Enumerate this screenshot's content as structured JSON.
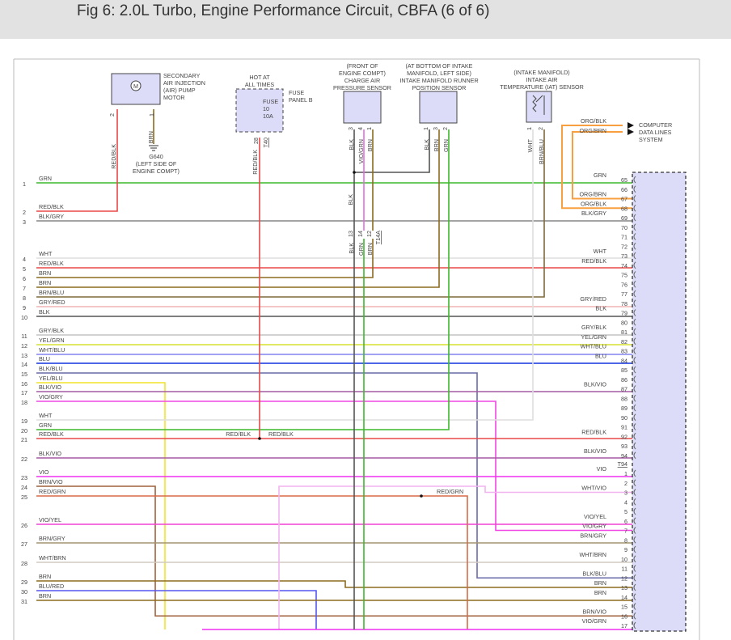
{
  "header": {
    "title": "Fig 6: 2.0L Turbo, Engine Performance Circuit, CBFA (6 of 6)"
  },
  "components": {
    "air_pump": {
      "label": [
        "SECONDARY",
        "AIR INJECTION",
        "(AIR) PUMP",
        "MOTOR"
      ],
      "symbol": "M",
      "pins": [
        "2",
        "1"
      ],
      "wires": [
        "RED/BLK",
        "BRN"
      ]
    },
    "ground": {
      "label": [
        "G640",
        "(LEFT SIDE OF",
        "ENGINE COMPT)"
      ]
    },
    "fuse_panel": {
      "hot": [
        "HOT AT",
        "ALL TIMES"
      ],
      "label": [
        "FUSE",
        "PANEL B"
      ],
      "fuse": [
        "FUSE",
        "10",
        "10A"
      ],
      "pin": "28",
      "connector": "T40",
      "wire": "RED/BLK"
    },
    "charge_air_sensor": {
      "label": [
        "(FRONT OF",
        "ENGINE COMPT)",
        "CHARGE AIR",
        "PRESSURE SENSOR"
      ],
      "pins": [
        "3",
        "4",
        "1"
      ],
      "wires": [
        "BLK",
        "VIO/GRN",
        "BRN"
      ]
    },
    "imrp_sensor": {
      "label": [
        "(AT BOTTOM OF INTAKE",
        "MANIFOLD, LEFT SIDE)",
        "INTAKE MANIFOLD RUNNER",
        "POSITION SENSOR"
      ],
      "pins": [
        "1",
        "3",
        "2"
      ],
      "wires": [
        "BLK",
        "BRN",
        "GRN"
      ]
    },
    "iat_sensor": {
      "label": [
        "(INTAKE MANIFOLD)",
        "INTAKE AIR",
        "TEMPERATURE (IAT) SENSOR"
      ],
      "pins": [
        "1",
        "2"
      ],
      "wires": [
        "WHT",
        "BRN/BLU"
      ]
    },
    "junction": {
      "pins": [
        "13",
        "14",
        "12"
      ],
      "wires": [
        "BLK",
        "GRN",
        "BRN"
      ],
      "connector": "T14A",
      "blk_label": "BLK"
    },
    "data_lines": {
      "label": [
        "COMPUTER",
        "DATA LINES",
        "SYSTEM"
      ],
      "wires": [
        "ORG/BLK",
        "ORG/BRN"
      ]
    },
    "splices": {
      "red_blk_left": "RED/BLK",
      "red_blk_right": "RED/BLK",
      "red_grn": "RED/GRN"
    }
  },
  "left_rows": [
    {
      "n": "1",
      "label": "GRN"
    },
    {
      "n": "2",
      "label": "RED/BLK"
    },
    {
      "n": "3",
      "label": "BLK/GRY"
    },
    {
      "n": "4",
      "label": "WHT"
    },
    {
      "n": "5",
      "label": "RED/BLK"
    },
    {
      "n": "6",
      "label": "BRN"
    },
    {
      "n": "7",
      "label": "BRN"
    },
    {
      "n": "8",
      "label": "BRN/BLU"
    },
    {
      "n": "9",
      "label": "GRY/RED"
    },
    {
      "n": "10",
      "label": "BLK"
    },
    {
      "n": "11",
      "label": "GRY/BLK"
    },
    {
      "n": "12",
      "label": "YEL/GRN"
    },
    {
      "n": "13",
      "label": "WHT/BLU"
    },
    {
      "n": "14",
      "label": "BLU"
    },
    {
      "n": "15",
      "label": "BLK/BLU"
    },
    {
      "n": "16",
      "label": "YEL/BLU"
    },
    {
      "n": "17",
      "label": "BLK/VIO"
    },
    {
      "n": "18",
      "label": "VIO/GRY"
    },
    {
      "n": "19",
      "label": "WHT"
    },
    {
      "n": "20",
      "label": "GRN"
    },
    {
      "n": "21",
      "label": "RED/BLK"
    },
    {
      "n": "22",
      "label": "BLK/VIO"
    },
    {
      "n": "23",
      "label": "VIO"
    },
    {
      "n": "24",
      "label": "BRN/VIO"
    },
    {
      "n": "25",
      "label": "RED/GRN"
    },
    {
      "n": "26",
      "label": "VIO/YEL"
    },
    {
      "n": "27",
      "label": "BRN/GRY"
    },
    {
      "n": "28",
      "label": "WHT/BRN"
    },
    {
      "n": "29",
      "label": "BRN"
    },
    {
      "n": "30",
      "label": "BLU/RED"
    },
    {
      "n": "31",
      "label": "BRN"
    }
  ],
  "right_pins_a": [
    {
      "n": "65",
      "label": "GRN"
    },
    {
      "n": "66",
      "label": ""
    },
    {
      "n": "67",
      "label": "ORG/BRN"
    },
    {
      "n": "68",
      "label": "ORG/BLK"
    },
    {
      "n": "69",
      "label": "BLK/GRY"
    },
    {
      "n": "70",
      "label": ""
    },
    {
      "n": "71",
      "label": ""
    },
    {
      "n": "72",
      "label": ""
    },
    {
      "n": "73",
      "label": "WHT"
    },
    {
      "n": "74",
      "label": "RED/BLK"
    },
    {
      "n": "75",
      "label": ""
    },
    {
      "n": "76",
      "label": ""
    },
    {
      "n": "77",
      "label": ""
    },
    {
      "n": "78",
      "label": "GRY/RED"
    },
    {
      "n": "79",
      "label": "BLK"
    },
    {
      "n": "80",
      "label": ""
    },
    {
      "n": "81",
      "label": "GRY/BLK"
    },
    {
      "n": "82",
      "label": "YEL/GRN"
    },
    {
      "n": "83",
      "label": "WHT/BLU"
    },
    {
      "n": "84",
      "label": "BLU"
    },
    {
      "n": "85",
      "label": ""
    },
    {
      "n": "86",
      "label": ""
    },
    {
      "n": "87",
      "label": "BLK/VIO"
    },
    {
      "n": "88",
      "label": ""
    },
    {
      "n": "89",
      "label": ""
    },
    {
      "n": "90",
      "label": ""
    },
    {
      "n": "91",
      "label": ""
    },
    {
      "n": "92",
      "label": "RED/BLK"
    },
    {
      "n": "93",
      "label": ""
    },
    {
      "n": "94",
      "label": "BLK/VIO"
    }
  ],
  "connector_b_name": "T94",
  "right_pins_b": [
    {
      "n": "1",
      "label": "VIO"
    },
    {
      "n": "2",
      "label": ""
    },
    {
      "n": "3",
      "label": "WHT/VIO"
    },
    {
      "n": "4",
      "label": ""
    },
    {
      "n": "5",
      "label": ""
    },
    {
      "n": "6",
      "label": "VIO/YEL"
    },
    {
      "n": "7",
      "label": "VIO/GRY"
    },
    {
      "n": "8",
      "label": "BRN/GRY"
    },
    {
      "n": "9",
      "label": ""
    },
    {
      "n": "10",
      "label": "WHT/BRN"
    },
    {
      "n": "11",
      "label": ""
    },
    {
      "n": "12",
      "label": "BLK/BLU"
    },
    {
      "n": "13",
      "label": "BRN"
    },
    {
      "n": "14",
      "label": "BRN"
    },
    {
      "n": "15",
      "label": ""
    },
    {
      "n": "16",
      "label": "BRN/VIO"
    },
    {
      "n": "17",
      "label": "VIO/GRN"
    }
  ],
  "colors": {
    "GRN": "#3cb82c",
    "RED/BLK": "#e84848",
    "BLK/GRY": "#858585",
    "WHT": "#dedede",
    "BRN": "#8b6b1e",
    "BRN/BLU": "#7f6a3a",
    "GRY/RED": "#f0b4b4",
    "BLK": "#555555",
    "GRY/BLK": "#c4c4c4",
    "YEL/GRN": "#d6e030",
    "WHT/BLU": "#8484f0",
    "BLU": "#1234e0",
    "BLK/BLU": "#6a6aa8",
    "YEL/BLU": "#f2e428",
    "BLK/VIO": "#a45aa4",
    "VIO/GRY": "#f046e4",
    "VIO": "#f030f0",
    "BRN/VIO": "#a0603c",
    "RED/GRN": "#d86a48",
    "VIO/YEL": "#f040d4",
    "BRN/GRY": "#a49470",
    "WHT/BRN": "#d2cac2",
    "BLU/RED": "#5656f2",
    "ORG": "#f8a040",
    "WHT/VIO": "#f2b4f0",
    "VIO/GRN": "#e070e0",
    "connector_fill": "#dcdcf8"
  }
}
